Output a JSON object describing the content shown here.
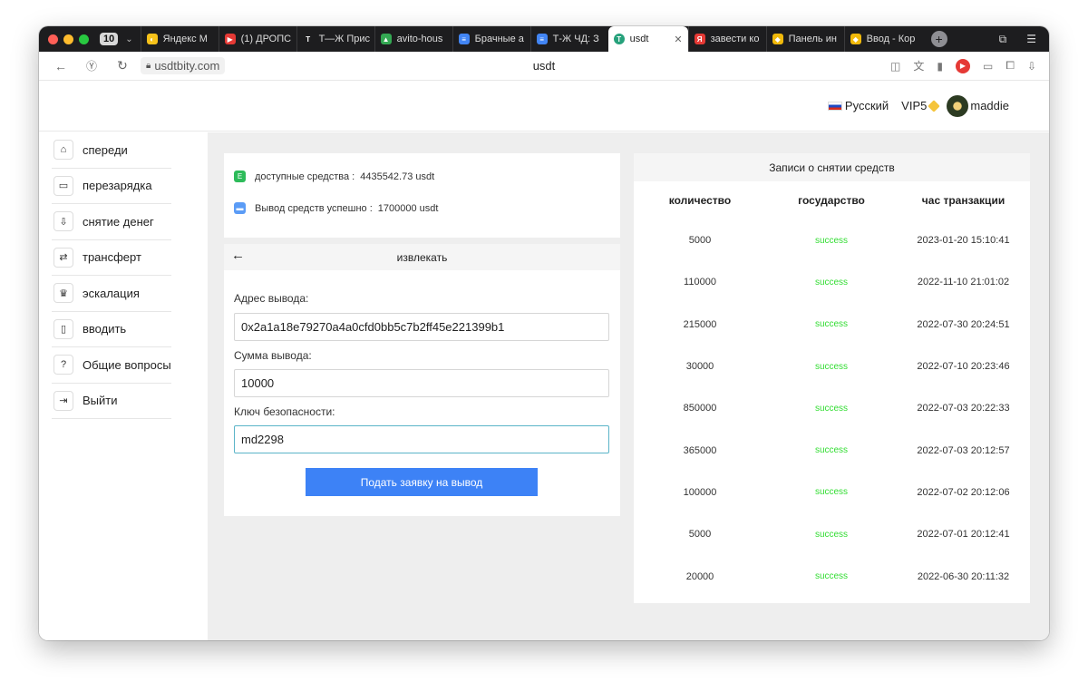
{
  "browser": {
    "tab_count": "10",
    "tabs": [
      {
        "label": "Яндекс М",
        "icon": "yandex-music-icon",
        "color": "#f7c21a"
      },
      {
        "label": "(1) ДРОПС",
        "icon": "youtube-icon",
        "color": "#e53935"
      },
      {
        "label": "Т—Ж Прис",
        "icon": "tzh-icon",
        "color": "#ffffff"
      },
      {
        "label": "avito-hous",
        "icon": "google-drive-icon",
        "color": "#34a853"
      },
      {
        "label": "Брачные а",
        "icon": "docs-icon",
        "color": "#4285f4"
      },
      {
        "label": "Т-Ж ЧД: З",
        "icon": "docs-icon",
        "color": "#4285f4"
      },
      {
        "label": "usdt",
        "icon": "tether-icon",
        "color": "#26a17b",
        "active": true
      },
      {
        "label": "завести ко",
        "icon": "yandex-icon",
        "color": "#e53935"
      },
      {
        "label": "Панель ин",
        "icon": "binance-icon",
        "color": "#f0b90b"
      },
      {
        "label": "Ввод - Кор",
        "icon": "binance-icon",
        "color": "#f0b90b"
      }
    ],
    "url": "usdtbity.com",
    "page_title": "usdt"
  },
  "header": {
    "language": "Русский",
    "vip": "VIP5",
    "username": "maddie"
  },
  "sidebar": {
    "items": [
      {
        "label": "спереди",
        "icon": "home-icon",
        "glyph": "⌂"
      },
      {
        "label": "перезарядка",
        "icon": "recharge-icon",
        "glyph": "▭"
      },
      {
        "label": "снятие денег",
        "icon": "withdraw-icon",
        "glyph": "⇩"
      },
      {
        "label": "трансферт",
        "icon": "transfer-icon",
        "glyph": "⇄"
      },
      {
        "label": "эскалация",
        "icon": "crown-icon",
        "glyph": "♛"
      },
      {
        "label": "вводить",
        "icon": "deposit-icon",
        "glyph": "▯"
      },
      {
        "label": "Общие вопросы",
        "icon": "question-icon",
        "glyph": "?"
      },
      {
        "label": "Выйти",
        "icon": "logout-icon",
        "glyph": "⇥"
      }
    ]
  },
  "balance": {
    "available_label": "доступные средства :",
    "available_value": "4435542.73 usdt",
    "withdrawn_label": "Вывод средств успешно :",
    "withdrawn_value": "1700000 usdt"
  },
  "withdraw": {
    "title": "извлекать",
    "address_label": "Адрес вывода:",
    "address_value": "0x2a1a18e79270a4a0cfd0bb5c7b2ff45e221399b1",
    "amount_label": "Сумма вывода:",
    "amount_value": "10000",
    "key_label": "Ключ безопасности:",
    "key_value": "md2298",
    "submit_label": "Подать заявку на вывод"
  },
  "records": {
    "title": "Записи о снятии средств",
    "columns": [
      "количество",
      "государство",
      "час транзакции"
    ],
    "rows": [
      [
        "5000",
        "success",
        "2023-01-20 15:10:41"
      ],
      [
        "110000",
        "success",
        "2022-11-10 21:01:02"
      ],
      [
        "215000",
        "success",
        "2022-07-30 20:24:51"
      ],
      [
        "30000",
        "success",
        "2022-07-10 20:23:46"
      ],
      [
        "850000",
        "success",
        "2022-07-03 20:22:33"
      ],
      [
        "365000",
        "success",
        "2022-07-03 20:12:57"
      ],
      [
        "100000",
        "success",
        "2022-07-02 20:12:06"
      ],
      [
        "5000",
        "success",
        "2022-07-01 20:12:41"
      ],
      [
        "20000",
        "success",
        "2022-06-30 20:11:32"
      ]
    ]
  }
}
